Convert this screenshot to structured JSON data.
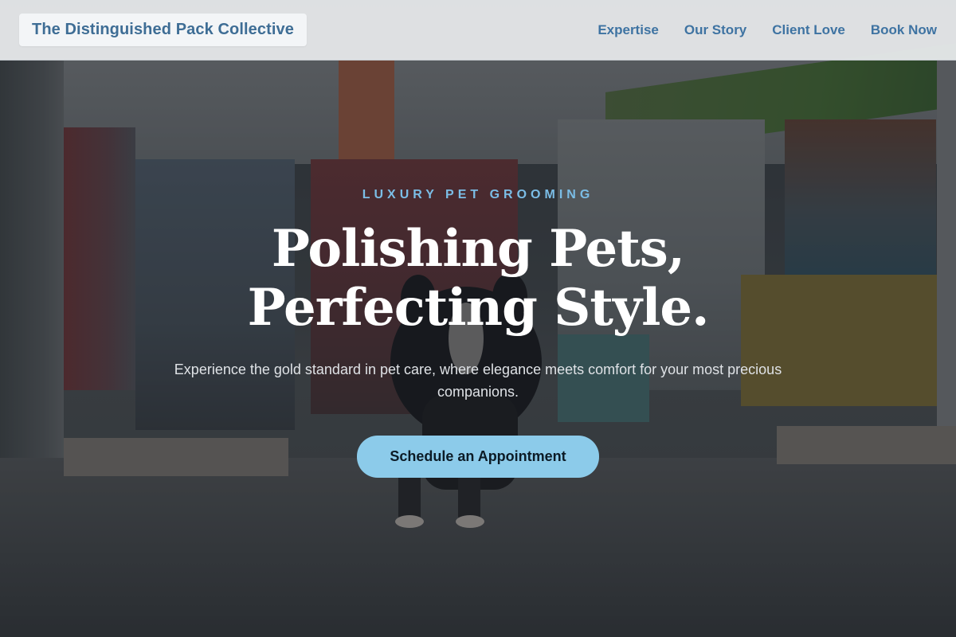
{
  "header": {
    "brand": "The Distinguished Pack Collective",
    "nav": [
      "Expertise",
      "Our Story",
      "Client Love",
      "Book Now"
    ]
  },
  "hero": {
    "eyebrow": "LUXURY PET GROOMING",
    "headline_line1": "Polishing Pets,",
    "headline_line2": "Perfecting Style.",
    "subtitle": "Experience the gold standard in pet care, where elegance meets comfort for your most precious companions.",
    "cta": "Schedule an Appointment"
  },
  "colors": {
    "accent": "#8ccbea",
    "eyebrow": "#7bbde6",
    "nav_link": "#3e73a2",
    "brand_text": "#3e6d95"
  },
  "background_image": "dog-in-pet-store-photo"
}
